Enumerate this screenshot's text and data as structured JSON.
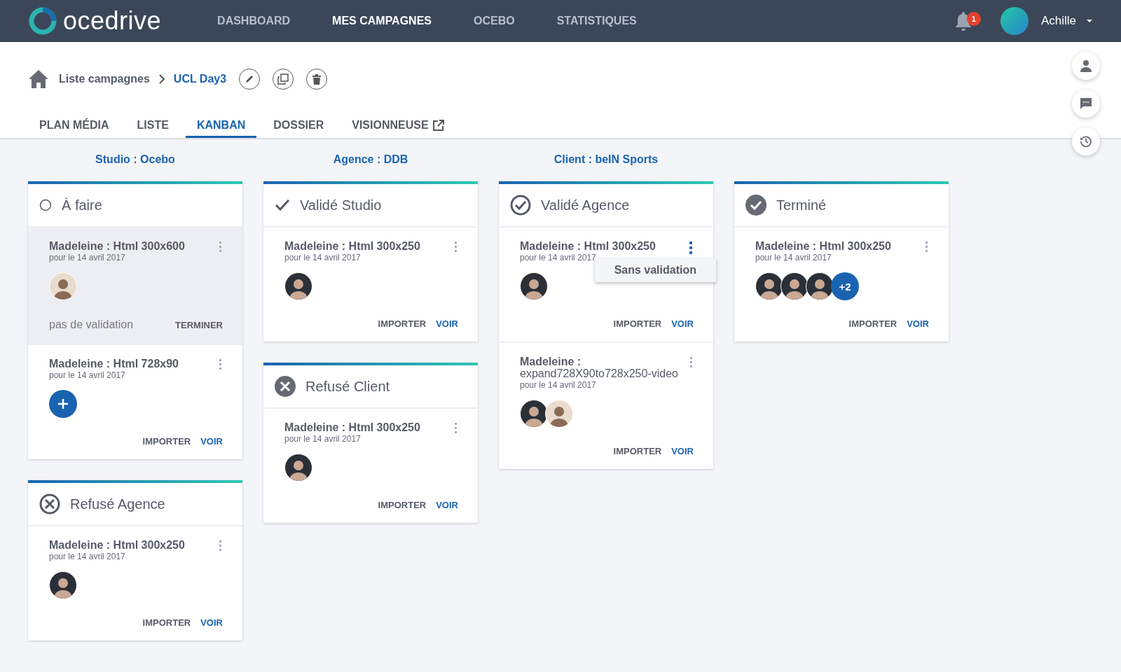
{
  "navbar": {
    "logo": "ocedrive",
    "items": [
      {
        "label": "DASHBOARD",
        "selected": false
      },
      {
        "label": "MES CAMPAGNES",
        "selected": true
      },
      {
        "label": "OCEBO",
        "selected": false
      },
      {
        "label": "STATISTIQUES",
        "selected": false
      }
    ],
    "notifications": "1",
    "user": "Achille"
  },
  "breadcrumb": {
    "parent": "Liste campagnes",
    "current": "UCL Day3"
  },
  "tabs": [
    {
      "label": "PLAN MÉDIA",
      "selected": false,
      "external": false
    },
    {
      "label": "LISTE",
      "selected": false,
      "external": false
    },
    {
      "label": "KANBAN",
      "selected": true,
      "external": false
    },
    {
      "label": "DOSSIER",
      "selected": false,
      "external": false
    },
    {
      "label": "VISIONNEUSE",
      "selected": false,
      "external": true
    }
  ],
  "columns": [
    {
      "header": "Studio : Ocebo",
      "lanes": [
        {
          "title": "À faire",
          "kind": "open",
          "cards": [
            {
              "title": "**Madeleine : Html 300x600**",
              "date": "pour le 14 avril 2017",
              "selected": true,
              "menu_open": false,
              "avatars": [
                {
                  "kind": "woman"
                }
              ],
              "note": "pas de validation",
              "actions": [
                {
                  "label": "TERMINER",
                  "kind": "secondary"
                }
              ]
            },
            {
              "title": "**Madeleine : Html 728x90**",
              "date": "pour le 14 avril 2017",
              "selected": false,
              "menu_open": false,
              "add_button": true,
              "actions": [
                {
                  "label": "IMPORTER",
                  "kind": "secondary"
                },
                {
                  "label": "VOIR",
                  "kind": "primary"
                }
              ]
            }
          ]
        },
        {
          "title": "Refusé Agence",
          "kind": "refused-outline",
          "cards": [
            {
              "title": "**Madeleine : Html 300x250**",
              "date": "pour le 14 avril 2017",
              "selected": false,
              "menu_open": false,
              "avatars": [
                {
                  "kind": "man"
                }
              ],
              "actions": [
                {
                  "label": "IMPORTER",
                  "kind": "secondary"
                },
                {
                  "label": "VOIR",
                  "kind": "primary"
                }
              ]
            }
          ]
        }
      ]
    },
    {
      "header": "Agence : DDB",
      "lanes": [
        {
          "title": "Validé Studio",
          "kind": "check",
          "cards": [
            {
              "title": "**Madeleine : Html 300x250**",
              "date": "pour le 14 avril 2017",
              "selected": false,
              "menu_open": false,
              "avatars": [
                {
                  "kind": "man"
                }
              ],
              "actions": [
                {
                  "label": "IMPORTER",
                  "kind": "secondary"
                },
                {
                  "label": "VOIR",
                  "kind": "primary"
                }
              ]
            }
          ]
        },
        {
          "title": "Refusé Client",
          "kind": "refused-filled",
          "cards": [
            {
              "title": "**Madeleine : Html 300x250**",
              "date": "pour le 14 avril 2017",
              "selected": false,
              "menu_open": false,
              "avatars": [
                {
                  "kind": "man"
                }
              ],
              "actions": [
                {
                  "label": "IMPORTER",
                  "kind": "secondary"
                },
                {
                  "label": "VOIR",
                  "kind": "primary"
                }
              ]
            }
          ]
        }
      ]
    },
    {
      "header": "Client : beIN Sports",
      "lanes": [
        {
          "title": "Validé Agence",
          "kind": "check-outline",
          "cards": [
            {
              "title": "**Madeleine : Html 300x250**",
              "date": "pour le 14 avril 2017",
              "selected": false,
              "menu_open": true,
              "menu_items": [
                "Sans validation"
              ],
              "avatars": [
                {
                  "kind": "man"
                }
              ],
              "actions": [
                {
                  "label": "IMPORTER",
                  "kind": "secondary"
                },
                {
                  "label": "VOIR",
                  "kind": "primary"
                }
              ]
            },
            {
              "title": "**Madeleine :** expand728X90to728x250-video",
              "date": "pour le 14 avril 2017",
              "selected": false,
              "menu_open": false,
              "avatars": [
                {
                  "kind": "man"
                },
                {
                  "kind": "woman"
                }
              ],
              "actions": [
                {
                  "label": "IMPORTER",
                  "kind": "secondary"
                },
                {
                  "label": "VOIR",
                  "kind": "primary"
                }
              ]
            }
          ]
        }
      ]
    },
    {
      "lanes": [
        {
          "title": "Terminé",
          "kind": "check-filled",
          "cards": [
            {
              "title": "**Madeleine : Html 300x250**",
              "date": "pour le 14 avril 2017",
              "selected": false,
              "menu_open": false,
              "avatars": [
                {
                  "kind": "man"
                },
                {
                  "kind": "man"
                },
                {
                  "kind": "man"
                }
              ],
              "more": "+2",
              "actions": [
                {
                  "label": "IMPORTER",
                  "kind": "secondary"
                },
                {
                  "label": "VOIR",
                  "kind": "primary"
                }
              ]
            }
          ]
        }
      ]
    }
  ]
}
